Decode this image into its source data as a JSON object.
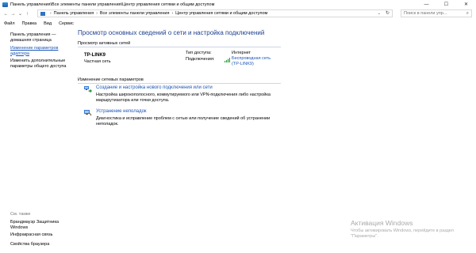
{
  "window": {
    "title": "Панель управления\\Все элементы панели управления\\Центр управления сетями и общим доступом",
    "controls": {
      "minimize": "—",
      "maximize": "☐",
      "close": "✕"
    }
  },
  "address": {
    "back": "←",
    "forward": "→",
    "recent": "⌄",
    "up": "↑",
    "crumbs": [
      "Панель управления",
      "Все элементы панели управления",
      "Центр управления сетями и общим доступом"
    ],
    "separator": "›",
    "dropdown": "⌄",
    "refresh": "↻",
    "search_placeholder": "Поиск в панели упр...",
    "search_icon": "⌕"
  },
  "menu": [
    "Файл",
    "Правка",
    "Вид",
    "Сервис"
  ],
  "left_pane": {
    "home": "Панель управления — домашняя страница",
    "adapter": "Изменение параметров адаптера",
    "advanced": "Изменить дополнительные параметры общего доступа",
    "see_also_title": "См. также",
    "see_also": [
      "Брандмауэр Защитника Windows",
      "Инфракрасная связь",
      "Свойства браузера"
    ]
  },
  "main": {
    "title": "Просмотр основных сведений о сети и настройка подключений",
    "active_section": "Просмотр активных сетей",
    "network": {
      "name": "TP-LINK9",
      "type": "Частная сеть",
      "access_label": "Тип доступа:",
      "access_value": "Интернет",
      "connections_label": "Подключения:",
      "connection_link": "Беспроводная сеть (TP-LINK9)"
    },
    "change_section": "Изменение сетевых параметров",
    "tasks": [
      {
        "link": "Создание и настройка нового подключения или сети",
        "desc": "Настройка широкополосного, коммутируемого или VPN-подключения либо настройка маршрутизатора или точки доступа.",
        "icon": "network-setup-icon"
      },
      {
        "link": "Устранение неполадок",
        "desc": "Диагностика и исправление проблем с сетью или получение сведений об устранении неполадок.",
        "icon": "troubleshoot-icon"
      }
    ]
  },
  "watermark": {
    "title": "Активация Windows",
    "text": "Чтобы активировать Windows, перейдите в раздел \"Параметры\"."
  },
  "colors": {
    "link": "#1a55b8",
    "title": "#1e3f8f",
    "wifi": "#2e9e3e"
  }
}
